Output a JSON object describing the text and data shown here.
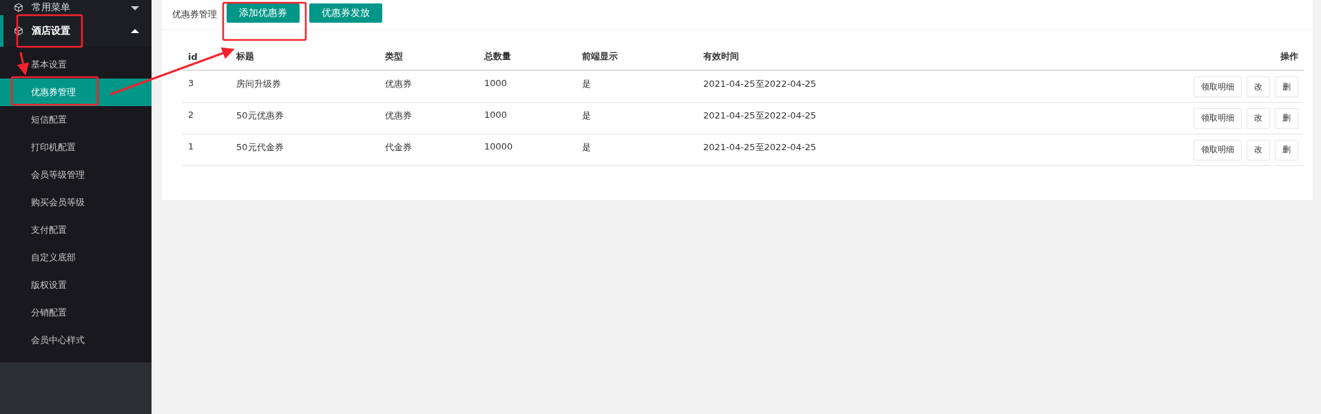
{
  "sidebar": {
    "menus": [
      {
        "label": "常用菜单",
        "expanded": false
      },
      {
        "label": "酒店设置",
        "expanded": true,
        "children": [
          {
            "label": "基本设置",
            "selected": false
          },
          {
            "label": "优惠券管理",
            "selected": true
          },
          {
            "label": "短信配置",
            "selected": false
          },
          {
            "label": "打印机配置",
            "selected": false
          },
          {
            "label": "会员等级管理",
            "selected": false
          },
          {
            "label": "购买会员等级",
            "selected": false
          },
          {
            "label": "支付配置",
            "selected": false
          },
          {
            "label": "自定义底部",
            "selected": false
          },
          {
            "label": "版权设置",
            "selected": false
          },
          {
            "label": "分销配置",
            "selected": false
          },
          {
            "label": "会员中心样式",
            "selected": false
          }
        ]
      }
    ]
  },
  "header": {
    "title": "优惠券管理",
    "buttons": [
      "添加优惠券",
      "优惠券发放"
    ]
  },
  "table": {
    "columns": [
      "id",
      "标题",
      "类型",
      "总数量",
      "前端显示",
      "有效时间",
      "操作"
    ],
    "rows": [
      {
        "cells": [
          "3",
          "房间升级券",
          "优惠券",
          "1000",
          "是",
          "2021-04-25至2022-04-25"
        ],
        "actions": [
          "领取明细",
          "改",
          "删"
        ]
      },
      {
        "cells": [
          "2",
          "50元优惠券",
          "优惠券",
          "1000",
          "是",
          "2021-04-25至2022-04-25"
        ],
        "actions": [
          "领取明细",
          "改",
          "删"
        ]
      },
      {
        "cells": [
          "1",
          "50元代金券",
          "代金券",
          "10000",
          "是",
          "2021-04-25至2022-04-25"
        ],
        "actions": [
          "领取明细",
          "改",
          "删"
        ]
      }
    ]
  }
}
